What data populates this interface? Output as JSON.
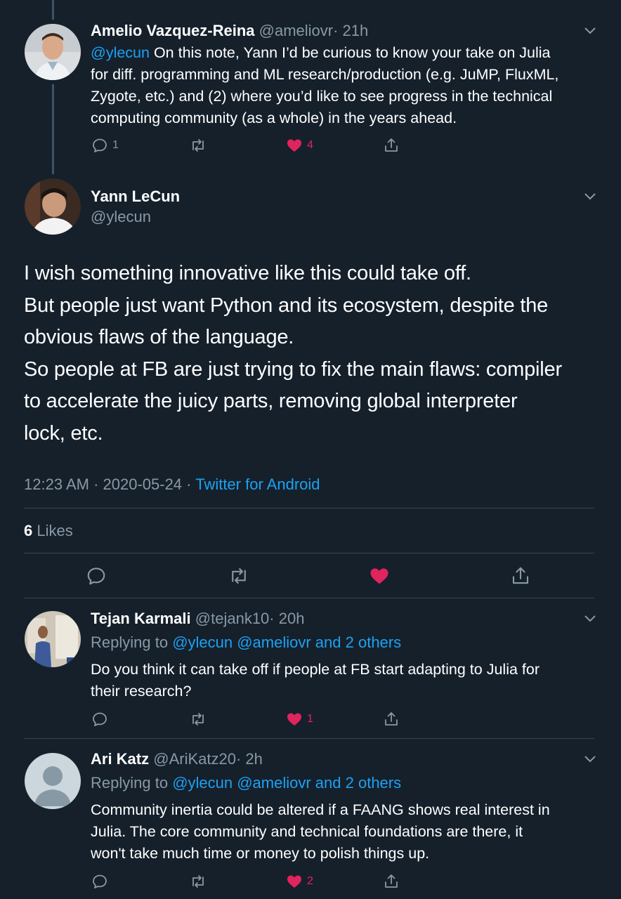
{
  "tweet1": {
    "name": "Amelio Vazquez-Reina",
    "handle": "@ameliovr",
    "time": "· 21h",
    "mention": "@ylecun",
    "text_line1": " On this note, Yann I’d be curious to know your take on Julia",
    "text_line2": "for diff. programming and ML research/production (e.g. JuMP, FluxML,",
    "text_line3": "Zygote, etc.) and (2) where you’d like to see progress in the technical",
    "text_line4": "computing community (as a whole) in the years ahead.",
    "replies": "1",
    "likes": "4"
  },
  "main": {
    "name": "Yann LeCun",
    "handle": "@ylecun",
    "line1": "I wish something innovative like this could take off.",
    "line2": "But people just want Python and its ecosystem, despite the",
    "line3": "obvious flaws of the language.",
    "line4": "So people at FB are just trying to fix the main flaws: compiler",
    "line5": "to accelerate the juicy parts, removing global interpreter",
    "line6": "lock, etc.",
    "timestamp": "12:23 AM · 2020-05-24 · ",
    "source": "Twitter for Android",
    "likes_count": "6",
    "likes_label": " Likes"
  },
  "reply1": {
    "name": "Tejan Karmali",
    "handle": "@tejank10",
    "time": "· 20h",
    "replying_prefix": "Replying to ",
    "replying_to": "@ylecun @ameliovr and 2 others",
    "text_line1": "Do you think it can take off if people at FB start adapting to Julia for",
    "text_line2": "their research?",
    "likes": "1"
  },
  "reply2": {
    "name": "Ari Katz",
    "handle": "@AriKatz20",
    "time": "· 2h",
    "replying_prefix": "Replying to ",
    "replying_to": "@ylecun @ameliovr and 2 others",
    "text_line1": "Community inertia could be altered if a FAANG shows real interest in",
    "text_line2": "Julia. The core community and technical foundations are there, it",
    "text_line3": "won't take much time or money to polish things up.",
    "likes": "2"
  },
  "colors": {
    "background": "#15202b",
    "link": "#1da1f2",
    "secondary": "#8899a6",
    "like": "#e0245e",
    "divider": "#38444d"
  }
}
